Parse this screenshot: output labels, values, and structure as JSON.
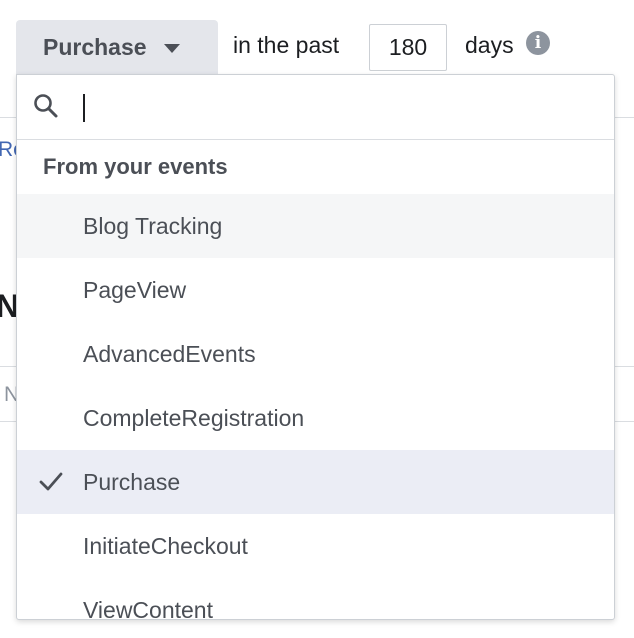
{
  "event_select": {
    "selected_label": "Purchase"
  },
  "retention": {
    "prefix": "in the past",
    "days_value": "180",
    "suffix": "days"
  },
  "dropdown": {
    "search_placeholder": "",
    "section_heading": "From your events",
    "options": [
      {
        "label": "Blog Tracking",
        "state": "hovered"
      },
      {
        "label": "PageView",
        "state": "normal"
      },
      {
        "label": "AdvancedEvents",
        "state": "normal"
      },
      {
        "label": "CompleteRegistration",
        "state": "normal"
      },
      {
        "label": "Purchase",
        "state": "selected"
      },
      {
        "label": "InitiateCheckout",
        "state": "normal"
      },
      {
        "label": "ViewContent",
        "state": "normal"
      }
    ]
  },
  "background": {
    "link_fragment": "Re",
    "heading_fragment": "N",
    "column_fragment": "N"
  },
  "icons": {
    "caret": "chevron-down-icon",
    "info": "info-icon",
    "search": "search-icon",
    "check": "check-icon"
  },
  "colors": {
    "button_bg": "#e4e6eb",
    "selected_bg": "#ebedf5",
    "hover_bg": "#f5f6f7",
    "link": "#4267b2",
    "text": "#4b4f56"
  }
}
